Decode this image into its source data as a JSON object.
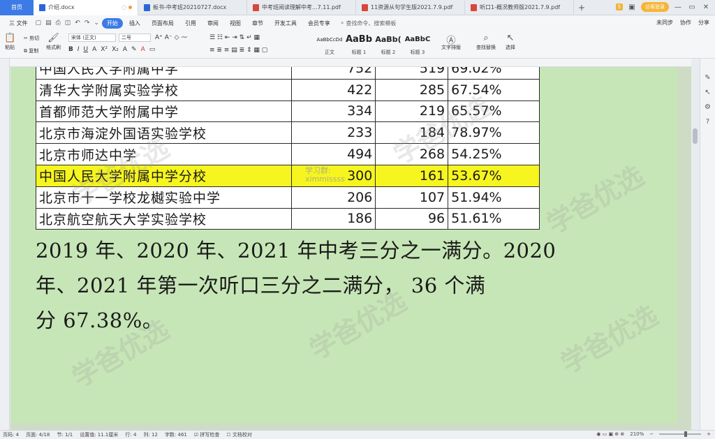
{
  "tabs": {
    "home": "首页",
    "documents": [
      {
        "title": "介绍.docx",
        "type": "word",
        "active": true
      },
      {
        "title": "板书-中考班20210727.docx",
        "type": "word",
        "active": false
      },
      {
        "title": "中考班阅读理解中考...7.11.pdf",
        "type": "pdf",
        "active": false
      },
      {
        "title": "11资源从句学生版2021.7.9.pdf",
        "type": "pdf",
        "active": false
      },
      {
        "title": "听口1-概况教师版2021.7.9.pdf",
        "type": "pdf",
        "active": false
      }
    ],
    "new_tab": "+",
    "count_badge": "5",
    "login": "访客登录"
  },
  "menu": {
    "file": "三 文件",
    "items": [
      "开始",
      "插入",
      "页面布局",
      "引用",
      "审阅",
      "视图",
      "章节",
      "开发工具",
      "会员专享"
    ],
    "active": "开始",
    "search": "查找命令、搜索模板",
    "right": [
      "未同步",
      "协作",
      "分享"
    ]
  },
  "toolbar": {
    "paste": "粘贴",
    "cut": "剪切",
    "copy": "复制",
    "format_painter": "格式刷",
    "font_name": "宋体 (正文)",
    "font_size": "二号",
    "styles": [
      {
        "preview": "AaBbCcDd",
        "label": "正文"
      },
      {
        "preview": "AaBb",
        "label": "标题 1"
      },
      {
        "preview": "AaBb(",
        "label": "标题 2"
      },
      {
        "preview": "AaBbC",
        "label": "标题 3"
      }
    ],
    "text_layout": "文字排版",
    "find_replace": "查找替换",
    "select": "选择"
  },
  "table_rows": [
    {
      "name": "中国人民大学附属中学",
      "n1": "752",
      "n2": "519",
      "pct": "69.02%",
      "highlight": false
    },
    {
      "name": "清华大学附属实验学校",
      "n1": "422",
      "n2": "285",
      "pct": "67.54%",
      "highlight": false
    },
    {
      "name": "首都师范大学附属中学",
      "n1": "334",
      "n2": "219",
      "pct": "65.57%",
      "highlight": false
    },
    {
      "name": "北京市海淀外国语实验学校",
      "n1": "233",
      "n2": "184",
      "pct": "78.97%",
      "highlight": false
    },
    {
      "name": "北京市师达中学",
      "n1": "494",
      "n2": "268",
      "pct": "54.25%",
      "highlight": false
    },
    {
      "name": "中国人民大学附属中学分校",
      "n1": "300",
      "n2": "161",
      "pct": "53.67%",
      "highlight": true
    },
    {
      "name": "北京市十一学校龙樾实验中学",
      "n1": "206",
      "n2": "107",
      "pct": "51.94%",
      "highlight": false
    },
    {
      "name": "北京航空航天大学实验学校",
      "n1": "186",
      "n2": "96",
      "pct": "51.61%",
      "highlight": false
    }
  ],
  "overlay_watermark": [
    "学习群:",
    "ximmissss"
  ],
  "body_text": [
    "2019 年、2020 年、2021 年中考三分之一满分。2020",
    "年、2021 年第一次听口三分之二满分，  36 个满",
    "分   67.38%。"
  ],
  "watermark_text": "学爸优选",
  "status": {
    "page_num": "页码: 4",
    "pages": "页面: 4/18",
    "section": "节: 1/1",
    "position": "设置值: 11.1厘米",
    "row": "行: 4",
    "col": "列: 12",
    "words": "字数: 461",
    "spell": "拼写检查",
    "proof": "文档校对",
    "zoom": "210%"
  }
}
